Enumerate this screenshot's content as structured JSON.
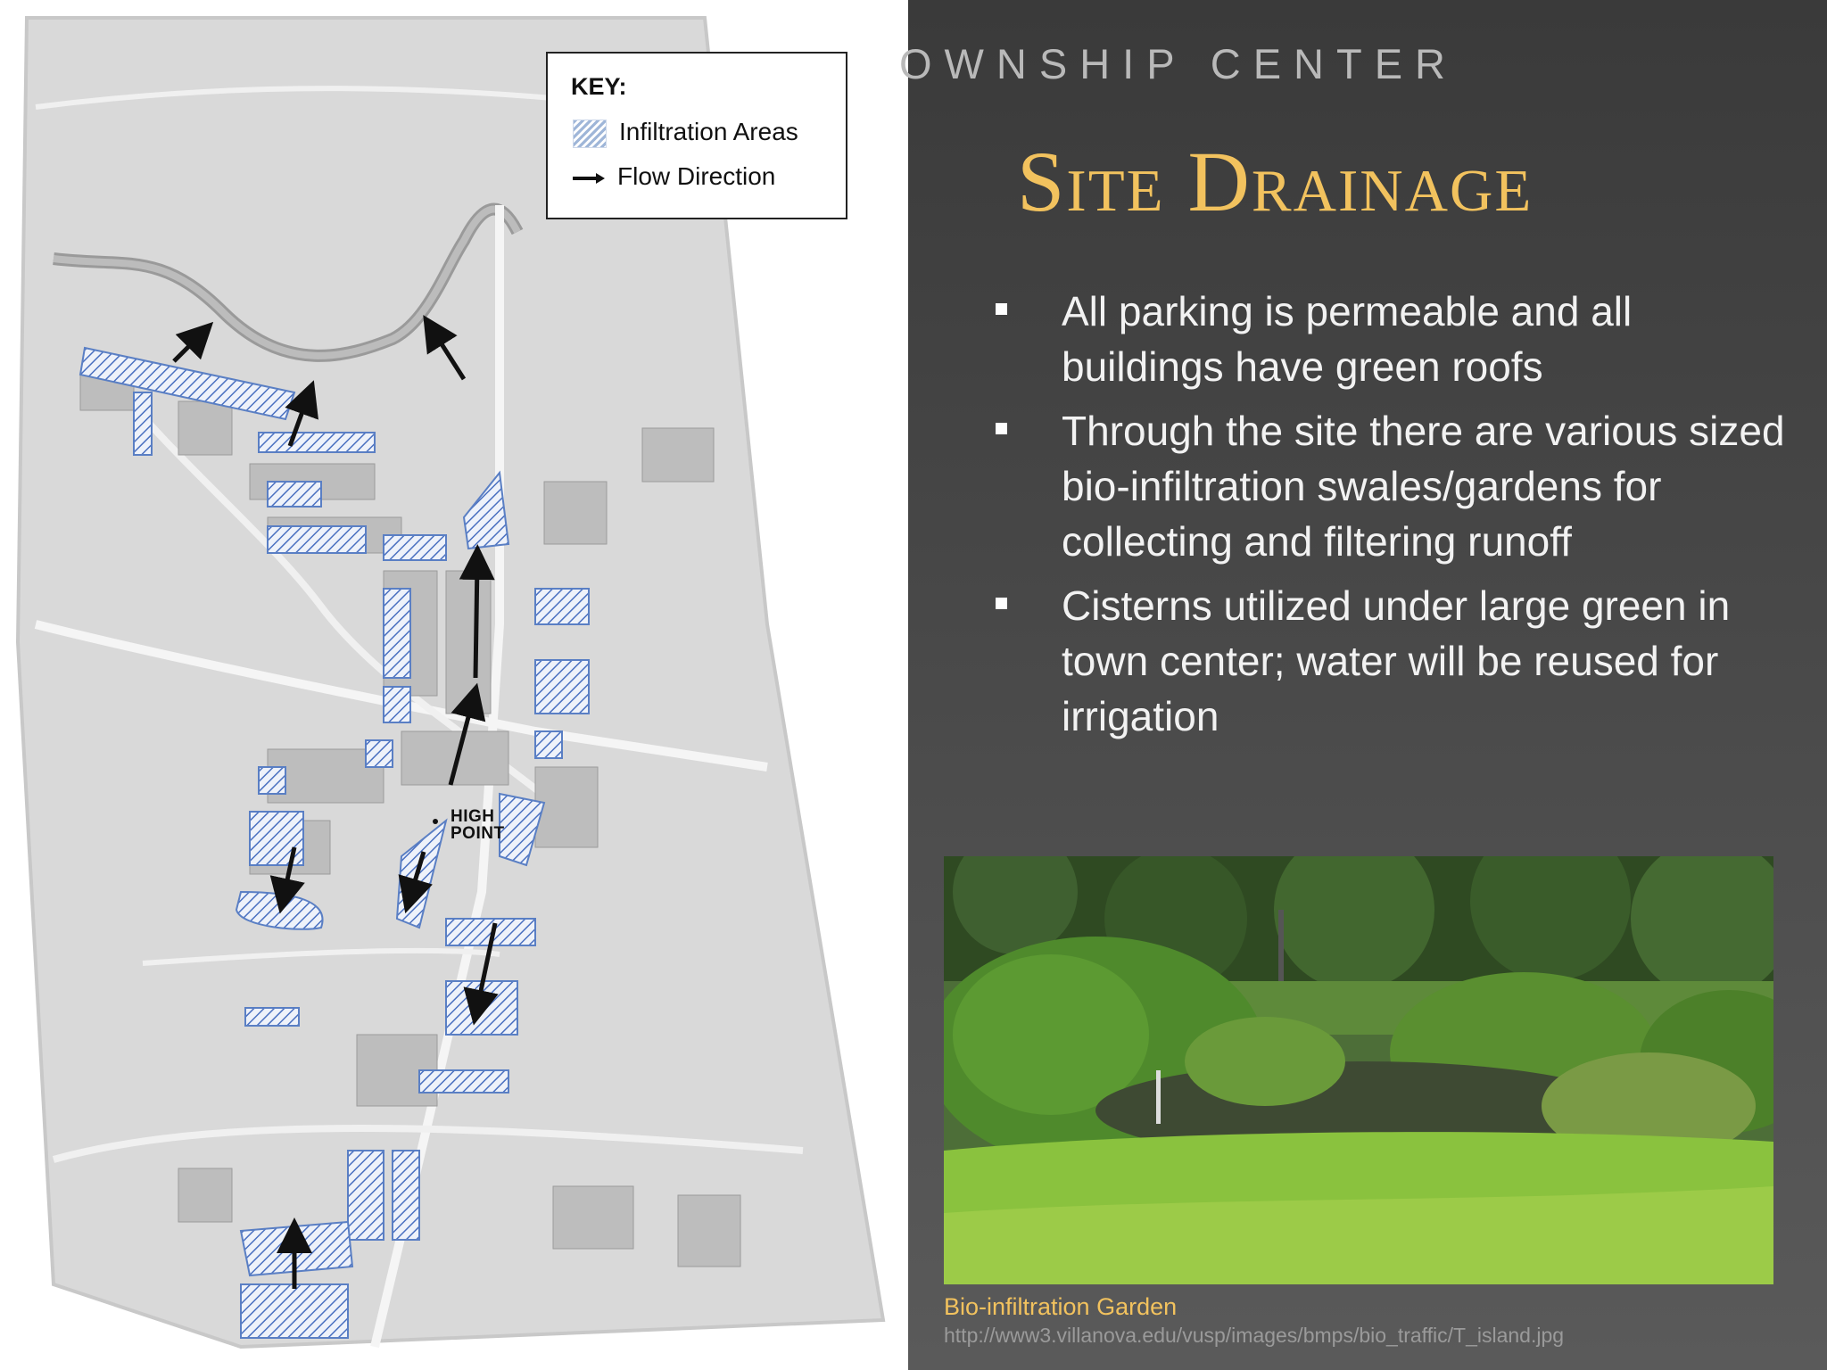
{
  "header": {
    "section_title": "OWNSHIP CENTER",
    "slide_title": "Site Drainage"
  },
  "bullets": [
    "All parking is permeable and all buildings have green roofs",
    "Through the site there are various sized bio-infiltration swales/gardens for collecting and filtering runoff",
    "Cisterns utilized under large green in town center; water will be reused for irrigation"
  ],
  "map": {
    "key_title": "KEY:",
    "key_items": [
      {
        "label": "Infiltration Areas",
        "icon": "hatched-swatch-icon"
      },
      {
        "label": "Flow Direction",
        "icon": "arrow-right-icon"
      }
    ],
    "high_point_label": [
      "HIGH",
      "POINT"
    ]
  },
  "photo": {
    "caption": "Bio-infiltration Garden",
    "source": "http://www3.villanova.edu/vusp/images/bmps/bio_traffic/T_island.jpg"
  },
  "colors": {
    "title_gold": "#f2c25e",
    "background_dark": "#454545",
    "infiltration_blue": "#5a7fc4"
  }
}
